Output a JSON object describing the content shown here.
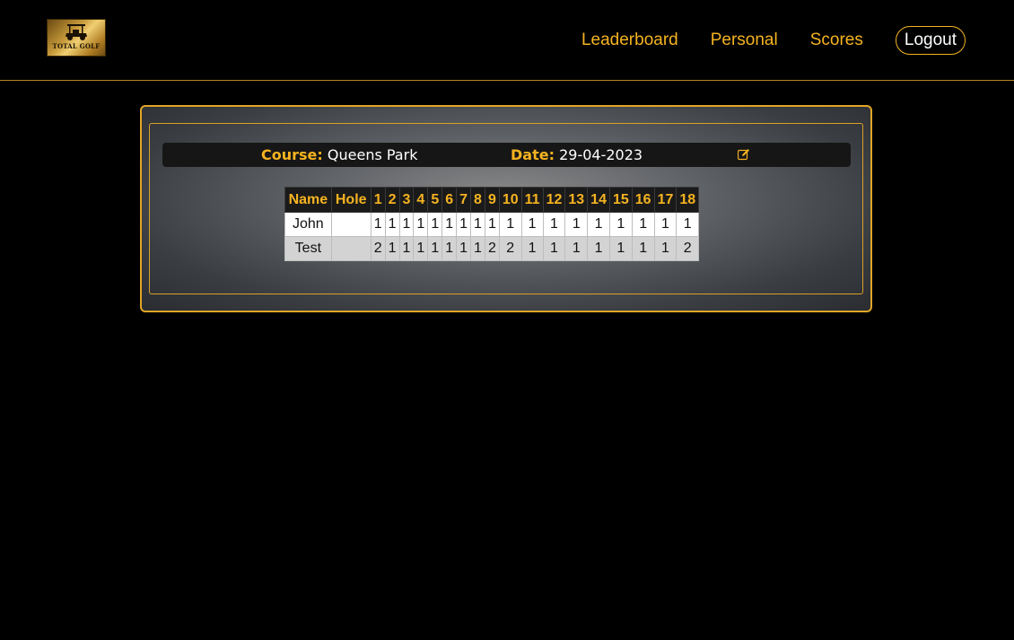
{
  "logo": {
    "text": "TOTAL GOLF",
    "icon": "golf-cart-icon"
  },
  "nav": {
    "leaderboard": "Leaderboard",
    "personal": "Personal",
    "scores": "Scores",
    "logout": "Logout"
  },
  "round": {
    "course_label": "Course:",
    "course": "Queens Park",
    "date_label": "Date:",
    "date": "29-04-2023",
    "edit_icon": "edit-icon"
  },
  "table": {
    "headers": [
      "Name",
      "Hole",
      "1",
      "2",
      "3",
      "4",
      "5",
      "6",
      "7",
      "8",
      "9",
      "10",
      "11",
      "12",
      "13",
      "14",
      "15",
      "16",
      "17",
      "18"
    ],
    "rows": [
      {
        "name": "John",
        "hole": "",
        "scores": [
          "1",
          "1",
          "1",
          "1",
          "1",
          "1",
          "1",
          "1",
          "1",
          "1",
          "1",
          "1",
          "1",
          "1",
          "1",
          "1",
          "1",
          "1"
        ]
      },
      {
        "name": "Test",
        "hole": "",
        "scores": [
          "2",
          "1",
          "1",
          "1",
          "1",
          "1",
          "1",
          "1",
          "2",
          "2",
          "1",
          "1",
          "1",
          "1",
          "1",
          "1",
          "1",
          "2"
        ]
      }
    ]
  },
  "colors": {
    "accent": "#f5b320",
    "border": "#e0a526",
    "background": "#000000"
  }
}
